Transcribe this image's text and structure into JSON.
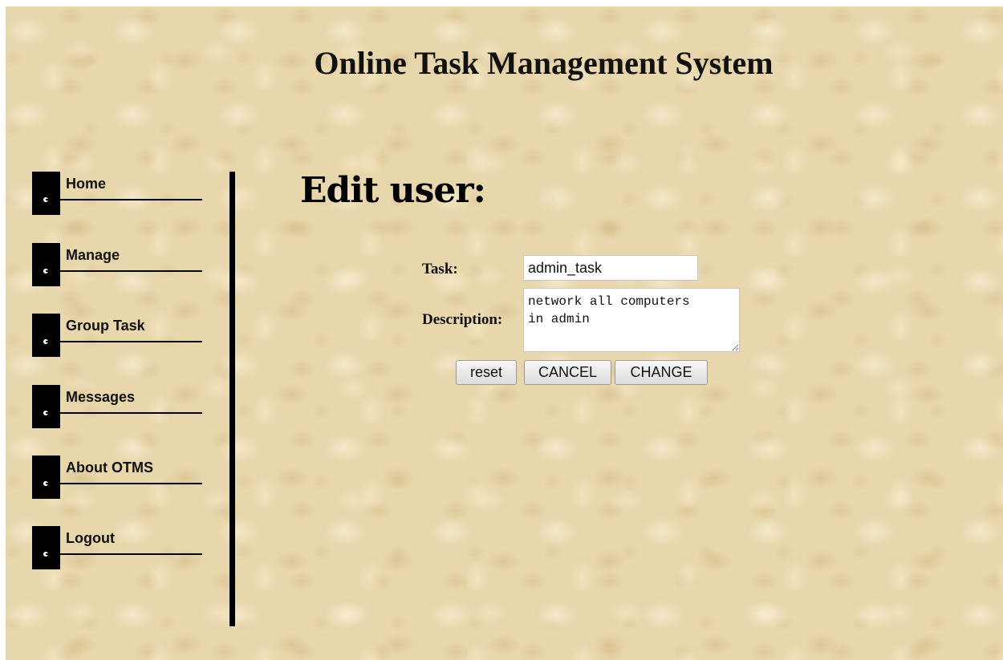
{
  "header": {
    "title": "Online Task Management System"
  },
  "sidebar": {
    "items": [
      {
        "label": "Home"
      },
      {
        "label": "Manage"
      },
      {
        "label": "Group Task"
      },
      {
        "label": "Messages"
      },
      {
        "label": "About OTMS"
      },
      {
        "label": "Logout"
      }
    ]
  },
  "main": {
    "heading": "Edit user:",
    "form": {
      "task_label": "Task:",
      "task_value": "admin_task",
      "description_label": "Description:",
      "description_value": "network all computers\nin admin",
      "reset_label": "reset",
      "cancel_label": "CANCEL",
      "change_label": "CHANGE"
    }
  },
  "colors": {
    "background": "#e8d6ac",
    "nav_block": "#000000",
    "text": "#111111"
  }
}
